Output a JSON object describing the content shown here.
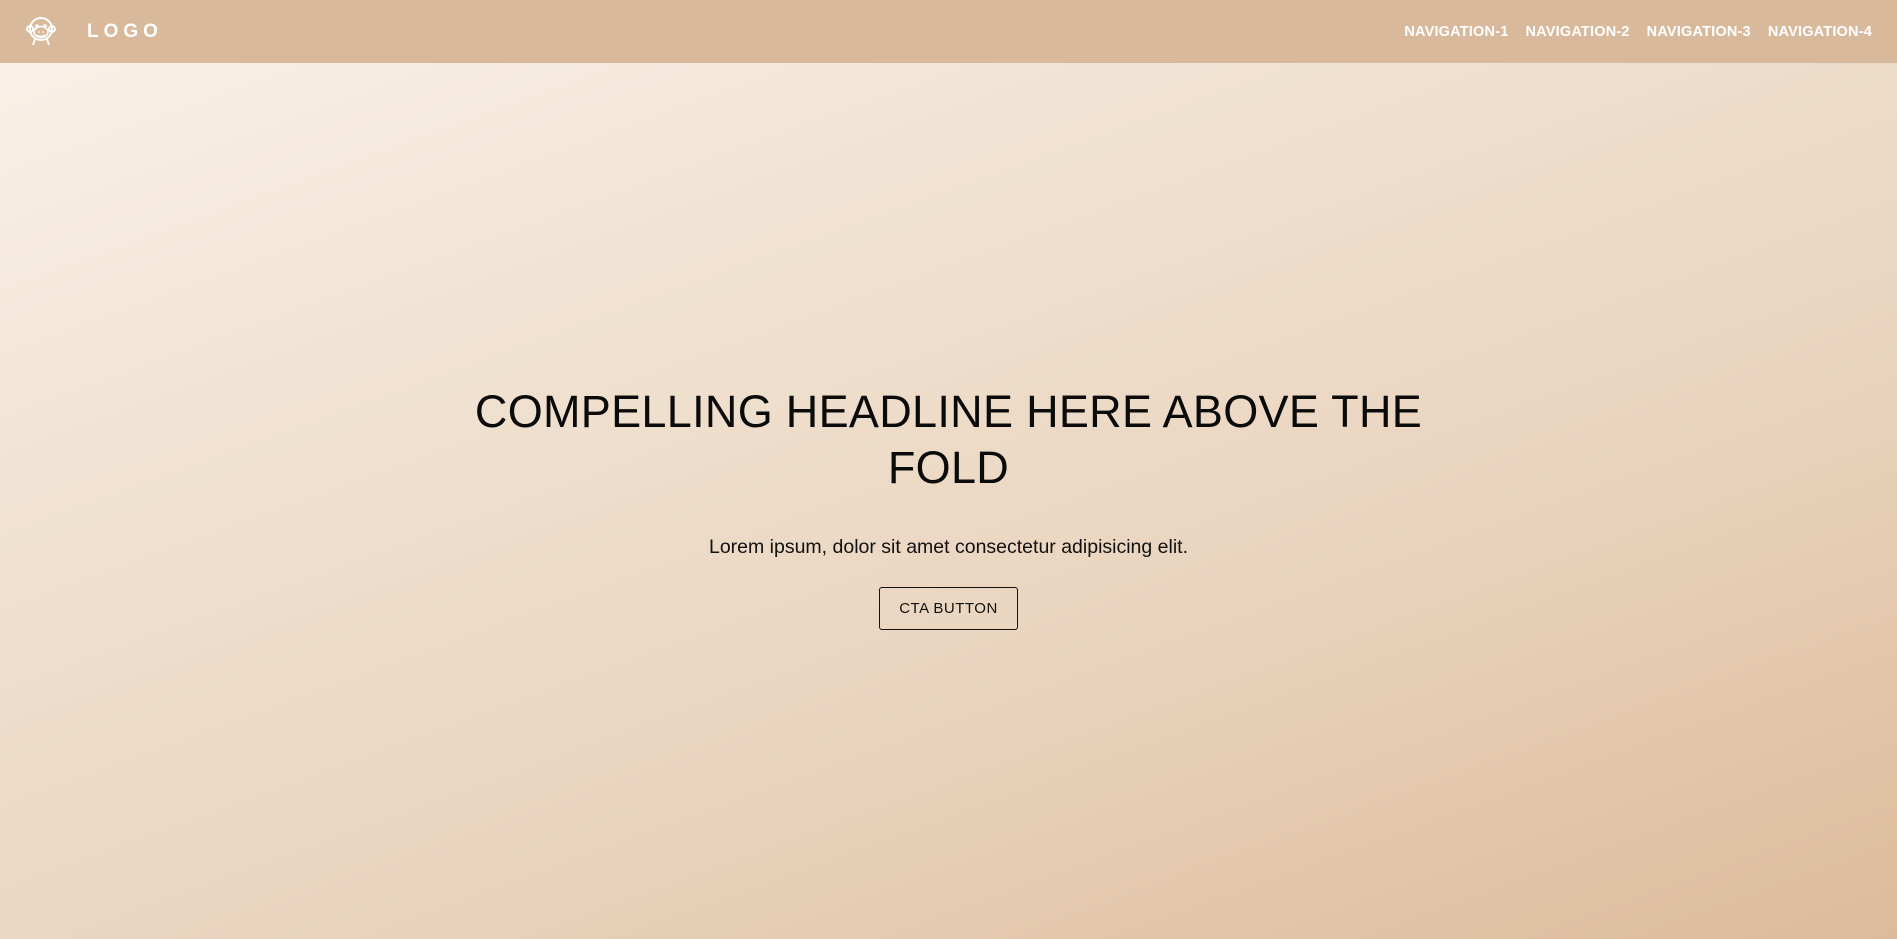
{
  "header": {
    "logo_text": "LOGO",
    "logo_icon": "monkey-face-icon",
    "nav": [
      {
        "label": "NAVIGATION-1"
      },
      {
        "label": "NAVIGATION-2"
      },
      {
        "label": "NAVIGATION-3"
      },
      {
        "label": "NAVIGATION-4"
      }
    ]
  },
  "hero": {
    "headline": "COMPELLING HEADLINE HERE ABOVE THE FOLD",
    "subtext": "Lorem ipsum, dolor sit amet consectetur adipisicing elit.",
    "cta_label": "CTA BUTTON"
  },
  "colors": {
    "header_bg": "#d9b99b",
    "header_text": "#ffffff",
    "hero_gradient_start": "#faf2ea",
    "hero_gradient_end": "#dcbb9c",
    "text": "#0b0b0b"
  }
}
